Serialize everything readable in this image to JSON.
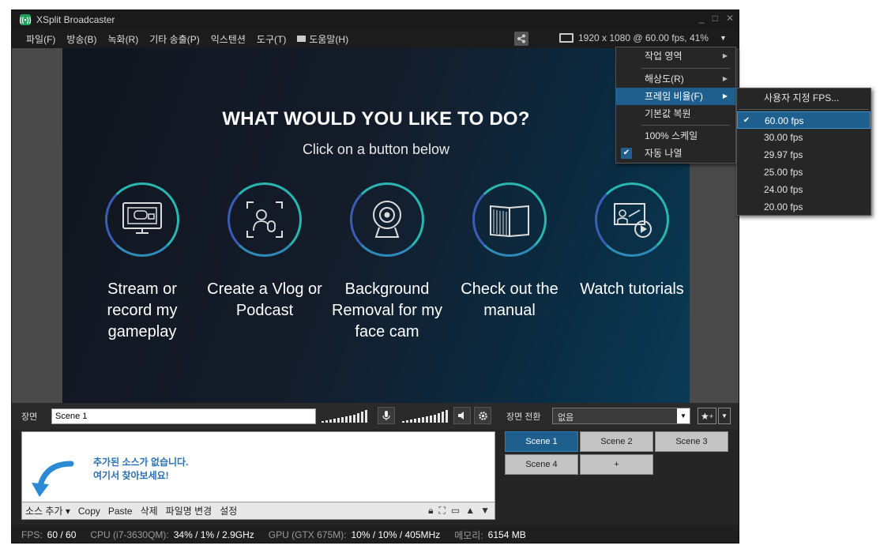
{
  "window": {
    "title": "XSplit Broadcaster",
    "controls": [
      "_",
      "□",
      "✕"
    ]
  },
  "menubar": {
    "items": [
      "파일(F)",
      "방송(B)",
      "녹화(R)",
      "기타 송출(P)",
      "익스텐션",
      "도구(T)",
      "도움말(H)"
    ],
    "resolution": "1920 x 1080 @ 60.00 fps, 41%"
  },
  "preview": {
    "title": "WHAT WOULD YOU LIKE TO DO?",
    "subtitle": "Click on a button below",
    "cards": [
      {
        "label": "Stream or record my gameplay",
        "icon": "gameplay-monitor-icon"
      },
      {
        "label": "Create a Vlog or Podcast",
        "icon": "vlog-podcast-icon"
      },
      {
        "label": "Background Removal for my face cam",
        "icon": "webcam-icon"
      },
      {
        "label": "Check out the manual",
        "icon": "manual-book-icon"
      },
      {
        "label": "Watch tutorials",
        "icon": "tutorial-video-icon"
      }
    ]
  },
  "scene_bar": {
    "label": "장면",
    "scene_name": "Scene 1",
    "transition_label": "장면 전환",
    "transition_value": "없음"
  },
  "sources": {
    "empty_line1": "추가된 소스가 없습니다.",
    "empty_line2": "여기서 찾아보세요!",
    "toolbar": [
      "소스 추가 ▾",
      "Copy",
      "Paste",
      "삭제",
      "파일명 변경",
      "설정"
    ]
  },
  "scenes": [
    "Scene 1",
    "Scene 2",
    "Scene 3",
    "Scene 4",
    "+"
  ],
  "status": {
    "fps_label": "FPS:",
    "fps_value": "60 / 60",
    "cpu_label": "CPU (i7-3630QM):",
    "cpu_value": "34% / 1% / 2.9GHz",
    "gpu_label": "GPU (GTX 675M):",
    "gpu_value": "10% / 10% / 405MHz",
    "mem_label": "메모리:",
    "mem_value": "6154 MB"
  },
  "dropdown": {
    "items": [
      "작업 영역",
      "해상도(R)",
      "프레임 비율(F)",
      "기본값 복원",
      "100% 스케일",
      "자동 나열"
    ],
    "checked": "자동 나열",
    "highlighted": "프레임 비율(F)"
  },
  "fps_submenu": {
    "items": [
      "사용자 지정 FPS...",
      "60.00 fps",
      "30.00 fps",
      "29.97 fps",
      "25.00 fps",
      "24.00 fps",
      "20.00 fps"
    ],
    "checked": "60.00 fps"
  },
  "colors": {
    "accent": "#1e5f8e",
    "teal": "#2ab6b0",
    "link_blue": "#2a6fb0"
  }
}
